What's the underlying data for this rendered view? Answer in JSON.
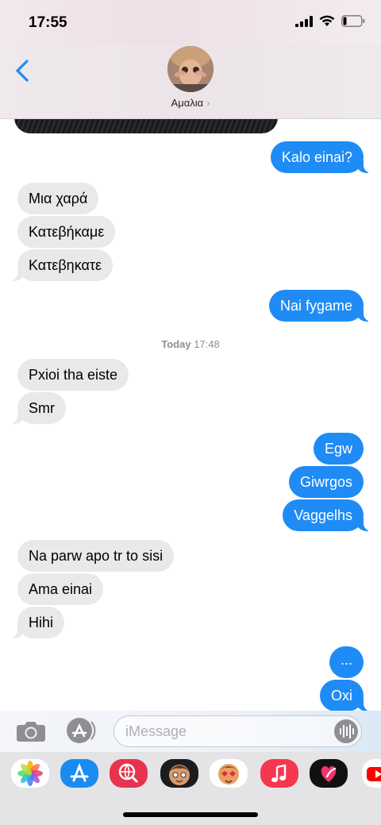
{
  "status": {
    "time": "17:55"
  },
  "contact": {
    "name": "Αμαλια",
    "chevron": "›"
  },
  "messages": [
    {
      "dir": "out",
      "text": "Kalo einai?"
    },
    {
      "dir": "in",
      "text": "Μια χαρά"
    },
    {
      "dir": "in",
      "text": "Κατεβήκαμε"
    },
    {
      "dir": "in",
      "text": "Κατεβηκατε"
    },
    {
      "dir": "out",
      "text": "Nai fygame"
    },
    {
      "dir": "in",
      "text": "Pxioi tha eiste"
    },
    {
      "dir": "in",
      "text": "Smr"
    },
    {
      "dir": "out",
      "text": "Egw"
    },
    {
      "dir": "out",
      "text": "Giwrgos"
    },
    {
      "dir": "out",
      "text": "Vaggelhs"
    },
    {
      "dir": "in",
      "text": "Na parw apo tr to sisi"
    },
    {
      "dir": "in",
      "text": "Ama einai"
    },
    {
      "dir": "in",
      "text": "Hihi"
    },
    {
      "dir": "out",
      "text": "..."
    },
    {
      "dir": "out",
      "text": "Oxi"
    }
  ],
  "timestamp": {
    "label": "Today",
    "time": "17:48"
  },
  "composer": {
    "placeholder": "iMessage"
  },
  "tray_apps": [
    {
      "name": "photos",
      "color": "#ffffff"
    },
    {
      "name": "app-store",
      "color": "#1a8cf0"
    },
    {
      "name": "images-search",
      "color": "#e8334d"
    },
    {
      "name": "memoji",
      "color": "#1c1c1e"
    },
    {
      "name": "animoji",
      "color": "#ffffff"
    },
    {
      "name": "music",
      "color": "#f7364f"
    },
    {
      "name": "digital-touch",
      "color": "#111111"
    },
    {
      "name": "youtube",
      "color": "#ff0000"
    }
  ],
  "colors": {
    "outgoing": "#1f8bf5",
    "incoming": "#e9e9eb",
    "accent": "#1f8bf5"
  }
}
